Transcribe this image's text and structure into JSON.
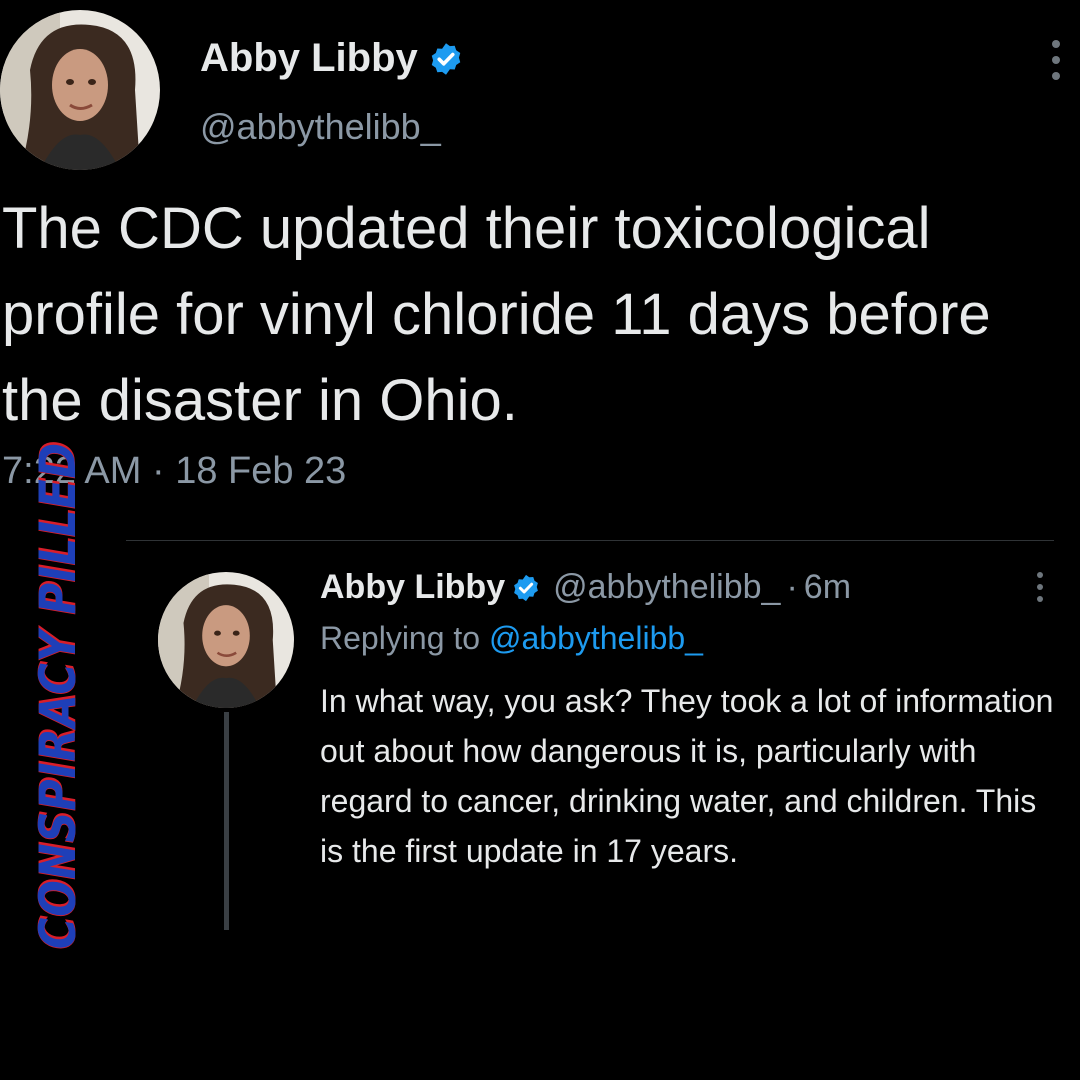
{
  "main_tweet": {
    "display_name": "Abby Libby",
    "handle": "@abbythelibb_",
    "text": "The CDC updated their toxicological profile for vinyl chloride 11 days before the disaster in Ohio.",
    "timestamp": "7:22 AM · 18 Feb 23",
    "verified_icon": "verified-badge-icon",
    "more_icon": "more-options-icon"
  },
  "reply_tweet": {
    "display_name": "Abby Libby",
    "handle": "@abbythelibb_",
    "separator": "·",
    "age": "6m",
    "replying_prefix": "Replying to",
    "replying_to": "@abbythelibb_",
    "text": "In what way, you ask? They took a lot of information out about how dangerous it is, particularly with regard to cancer, drinking water, and children. This is the first update in 17 years."
  },
  "watermark": {
    "text": "CONSPIRACY PILLED"
  },
  "colors": {
    "background": "#000000",
    "primary_text": "#e7e9ea",
    "secondary_text": "#8b98a5",
    "link": "#1d9bf0",
    "verified": "#1d9bf0",
    "watermark_blue": "#1e3fb8",
    "watermark_red": "#d81e2a"
  }
}
